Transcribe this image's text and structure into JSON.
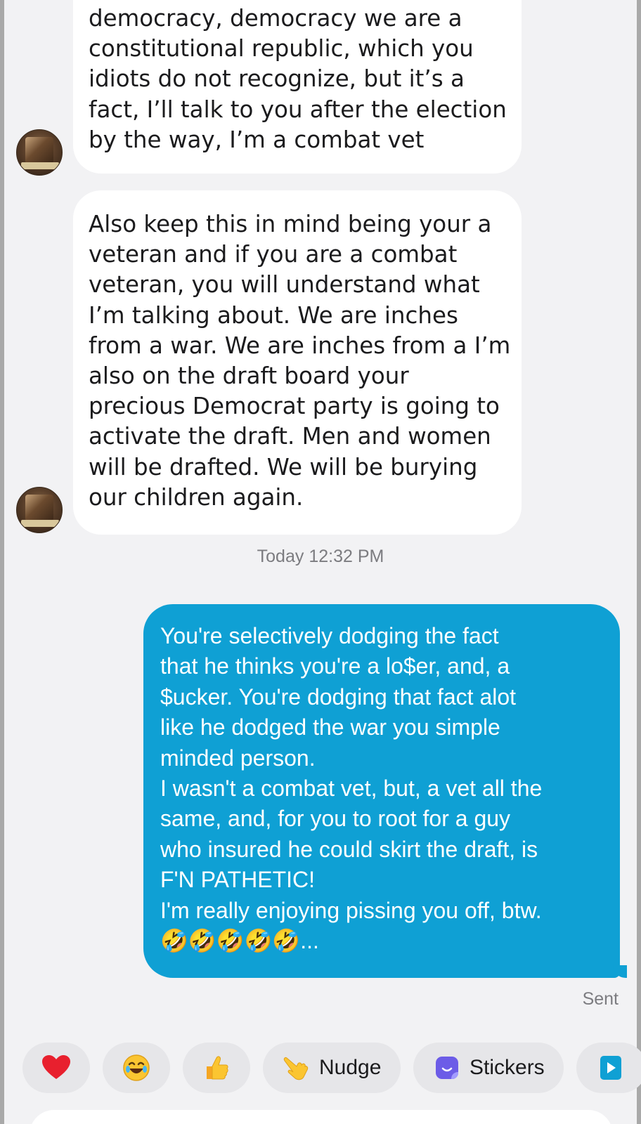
{
  "thread": {
    "incoming_1": {
      "lines": [
        "democracy, democracy we are a",
        "constitutional republic, which you",
        "idiots do not recognize, but it’s a",
        "fact, I’ll talk to you after the election",
        "by the way, I’m a combat vet"
      ]
    },
    "incoming_2": {
      "lines": [
        "Also keep this in mind being your a",
        "veteran and if you are a combat",
        "veteran, you will understand what",
        "I’m talking about. We are inches",
        "from a war. We are inches from a I’m",
        "also on the draft board your",
        "precious Democrat party is going to",
        "activate the draft. Men and women",
        "will be drafted. We will be burying",
        "our children again."
      ]
    },
    "timestamp": "Today 12:32 PM",
    "outgoing": {
      "lines": [
        "You're selectively dodging the fact",
        "that he thinks you're a lo$er, and, a",
        "$ucker.  You're dodging that fact alot",
        "like he dodged the war you simple",
        "minded person.",
        "I wasn't a combat vet, but, a vet all the",
        "same, and, for you to root for a guy",
        "who insured he could skirt the draft, is",
        "F'N PATHETIC!",
        "I'm really enjoying pissing you off, btw."
      ],
      "emoji_line": "🤣🤣🤣🤣🤣...",
      "status": "Sent"
    }
  },
  "quick_reactions": {
    "heart_icon": "red-heart-icon",
    "laugh_icon": "laughing-face-icon",
    "thumb_icon": "thumbs-up-icon",
    "nudge_label": "Nudge",
    "stickers_label": "Stickers"
  },
  "colors": {
    "outgoing_bubble": "#0fa0d4",
    "incoming_bubble": "#ffffff",
    "background": "#f2f2f4"
  }
}
